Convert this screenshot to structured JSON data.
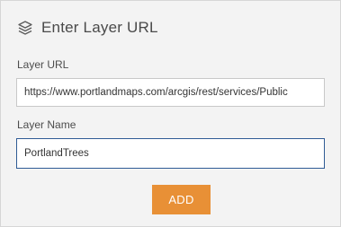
{
  "header": {
    "icon": "layers-icon",
    "title": "Enter Layer URL"
  },
  "form": {
    "layer_url": {
      "label": "Layer URL",
      "value": "https://www.portlandmaps.com/arcgis/rest/services/Public"
    },
    "layer_name": {
      "label": "Layer Name",
      "value": "PortlandTrees"
    }
  },
  "actions": {
    "add_label": "ADD"
  },
  "colors": {
    "accent": "#e89036",
    "focus_border": "#2f5b95",
    "panel_bg": "#f3f3f3"
  }
}
